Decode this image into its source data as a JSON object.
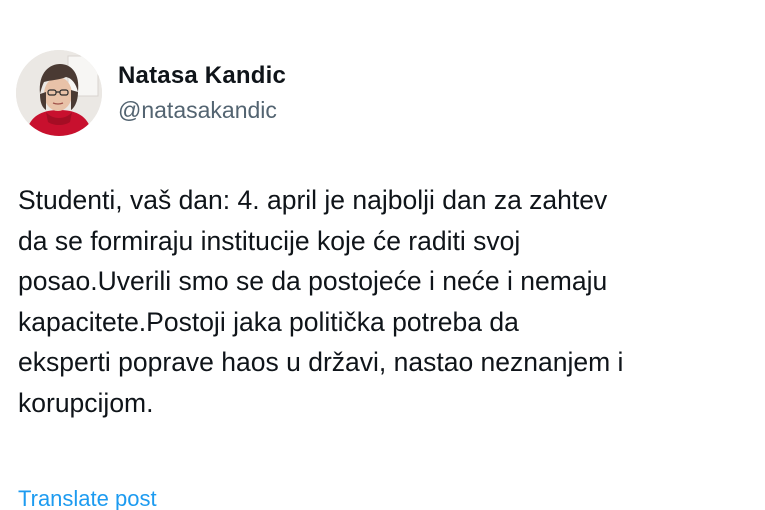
{
  "author": {
    "display_name": "Natasa Kandic",
    "handle": "@natasakandic",
    "avatar_icon": "profile-photo"
  },
  "post": {
    "text": "Studenti, vaš dan:  4. april je najbolji dan za zahtev\nda se formiraju institucije koje će raditi svoj\nposao.Uverili smo se da postojeće i neće i nemaju\nkapacitete.Postoji jaka politička potreba da\neksperti poprave haos u državi, nastao neznanjem i\nkorupcijom.",
    "translate_label": "Translate post"
  },
  "colors": {
    "text": "#0f1419",
    "secondary": "#536471",
    "link": "#1d9bf0"
  }
}
